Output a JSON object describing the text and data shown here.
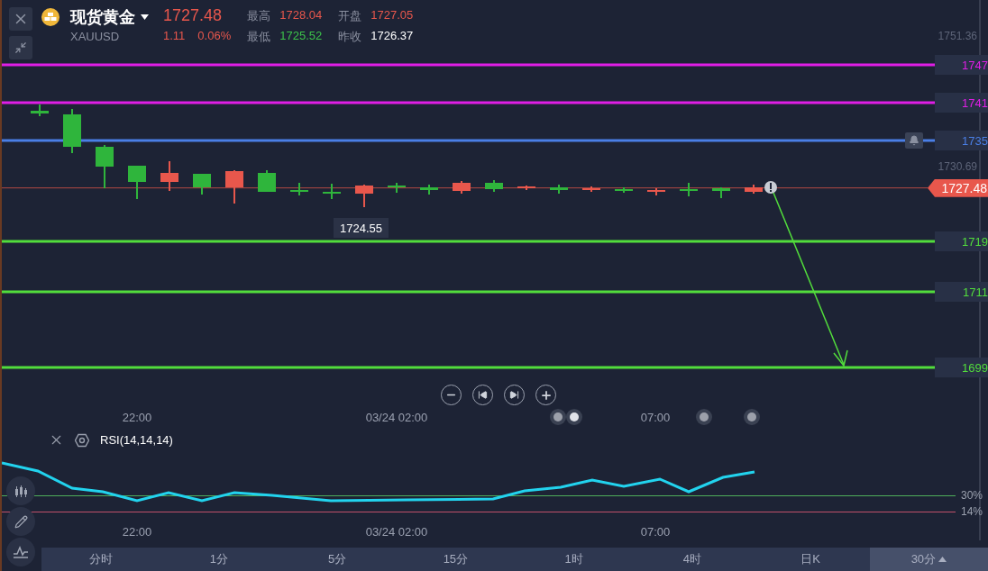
{
  "header": {
    "name": "现货黄金",
    "code": "XAUUSD",
    "price": "1727.48",
    "change": "1.11",
    "change_pct": "0.06%",
    "stats": [
      {
        "label": "最高",
        "value": "1728.04",
        "color": "#e8574c"
      },
      {
        "label": "开盘",
        "value": "1727.05",
        "color": "#e8574c"
      },
      {
        "label": "最低",
        "value": "1725.52",
        "color": "#3cc24a"
      },
      {
        "label": "昨收",
        "value": "1726.37",
        "color": "#ffffff"
      }
    ]
  },
  "price_axis": [
    "1751.36",
    "1730.69"
  ],
  "price_levels": [
    {
      "label": "1747",
      "color": "#e01ee6"
    },
    {
      "label": "1741",
      "color": "#e01ee6"
    },
    {
      "label": "1735",
      "color": "#4a7fe6"
    },
    {
      "label": "1719",
      "color": "#52dd3c"
    },
    {
      "label": "1711",
      "color": "#52dd3c"
    },
    {
      "label": "1699",
      "color": "#52dd3c"
    }
  ],
  "current_price": "1727.48",
  "low_marker": "1724.55",
  "time_axis": [
    "22:00",
    "03/24 02:00",
    "07:00"
  ],
  "rsi": {
    "title": "RSI(14,14,14)",
    "levels": [
      {
        "label": "30%",
        "color": "#4fae5a"
      },
      {
        "label": "14%",
        "color": "#c0506a"
      }
    ],
    "time_axis": [
      "22:00",
      "03/24 02:00",
      "07:00"
    ]
  },
  "periods": [
    {
      "label": "分时",
      "selected": false,
      "dropdown": false
    },
    {
      "label": "1分",
      "selected": false,
      "dropdown": false
    },
    {
      "label": "5分",
      "selected": false,
      "dropdown": false
    },
    {
      "label": "15分",
      "selected": false,
      "dropdown": false
    },
    {
      "label": "1时",
      "selected": false,
      "dropdown": false
    },
    {
      "label": "4时",
      "selected": false,
      "dropdown": false
    },
    {
      "label": "日K",
      "selected": false,
      "dropdown": false
    },
    {
      "label": "30分",
      "selected": true,
      "dropdown": true
    }
  ]
}
